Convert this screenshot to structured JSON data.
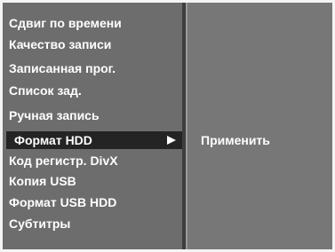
{
  "menu": {
    "items": [
      {
        "label": "Сдвиг по времени"
      },
      {
        "label": "Качество записи"
      },
      {
        "label": "Записанная прог."
      },
      {
        "label": "Список зад."
      },
      {
        "label": "Ручная запись"
      },
      {
        "label": "Формат HDD",
        "selected": true,
        "has_submenu": true
      },
      {
        "label": "Код регистр. DivX"
      },
      {
        "label": "Копия USB"
      },
      {
        "label": "Формат USB HDD"
      },
      {
        "label": "Субтитры"
      }
    ]
  },
  "submenu": {
    "items": [
      {
        "label": "Применить"
      }
    ]
  },
  "icons": {
    "selected_arrow": "arrow-right-icon"
  },
  "colors": {
    "panel_background": "#6d6d6d",
    "selected_background": "#242424",
    "text": "#ffffff"
  }
}
